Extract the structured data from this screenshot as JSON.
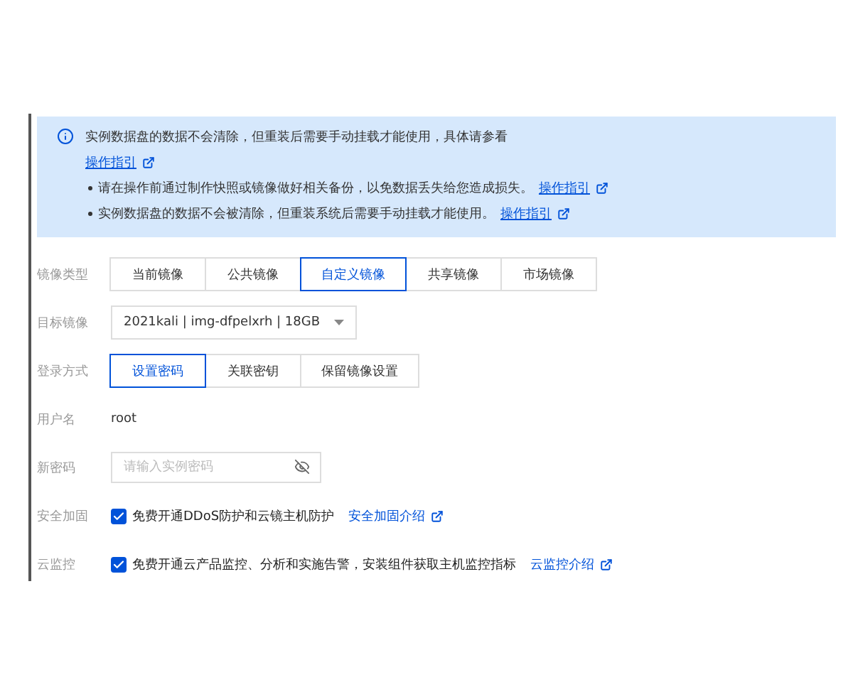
{
  "notice": {
    "intro": "实例数据盘的数据不会清除，但重装后需要手动挂载才能使用，具体请参看",
    "intro_link": "操作指引",
    "bullets": [
      {
        "text": "请在操作前通过制作快照或镜像做好相关备份，以免数据丢失给您造成损失。",
        "link": "操作指引"
      },
      {
        "text": "实例数据盘的数据不会被清除，但重装系统后需要手动挂载才能使用。",
        "link": "操作指引"
      }
    ]
  },
  "form": [
    {
      "kind": "segments",
      "label": "镜像类型",
      "options": [
        {
          "label": "当前镜像",
          "selected": false
        },
        {
          "label": "公共镜像",
          "selected": false
        },
        {
          "label": "自定义镜像",
          "selected": true
        },
        {
          "label": "共享镜像",
          "selected": false
        },
        {
          "label": "市场镜像",
          "selected": false
        }
      ]
    },
    {
      "kind": "select",
      "label": "目标镜像",
      "value": "2021kali | img-dfpelxrh | 18GB"
    },
    {
      "kind": "segments",
      "label": "登录方式",
      "options": [
        {
          "label": "设置密码",
          "selected": true
        },
        {
          "label": "关联密钥",
          "selected": false
        },
        {
          "label": "保留镜像设置",
          "selected": false
        }
      ]
    },
    {
      "kind": "text",
      "label": "用户名",
      "value": "root"
    },
    {
      "kind": "password",
      "label": "新密码",
      "placeholder": "请输入实例密码"
    },
    {
      "kind": "checkbox",
      "label": "安全加固",
      "text": "免费开通DDoS防护和云镜主机防护",
      "link": "安全加固介绍",
      "checked": true
    },
    {
      "kind": "checkbox",
      "label": "云监控",
      "text": "免费开通云产品监控、分析和实施告警，安装组件获取主机监控指标",
      "link": "云监控介绍",
      "checked": true
    }
  ]
}
